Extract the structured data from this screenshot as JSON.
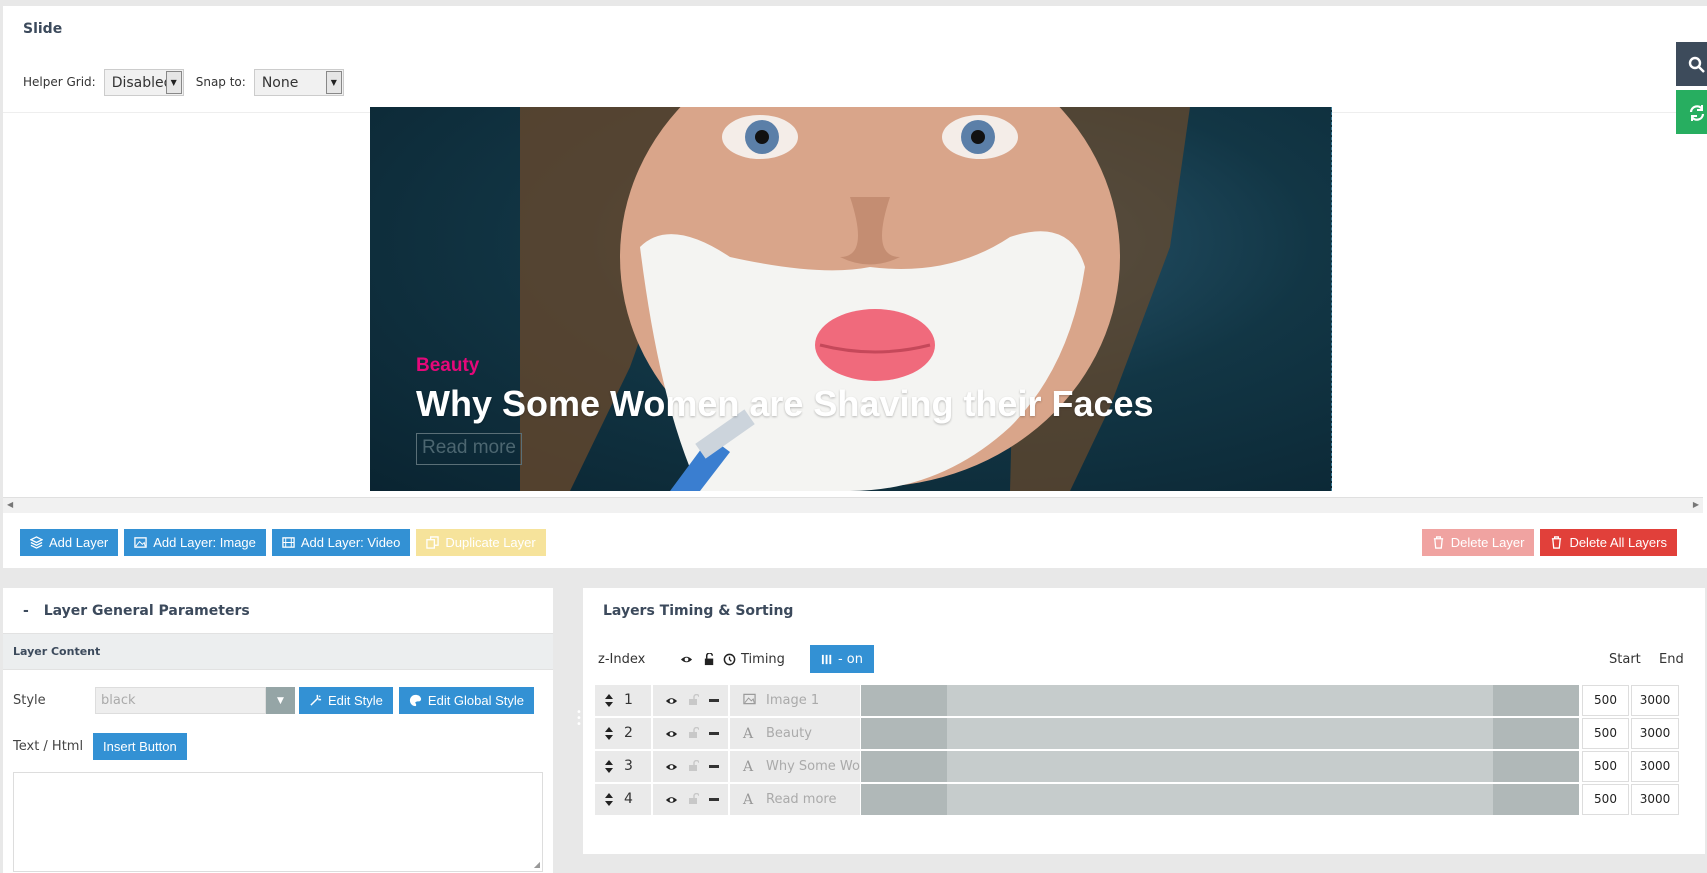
{
  "slide": {
    "title": "Slide",
    "helper_grid_label": "Helper Grid:",
    "helper_grid_value": "Disabled",
    "snap_label": "Snap to:",
    "snap_value": "None"
  },
  "canvas": {
    "layer_beauty": "Beauty",
    "layer_headline": "Why Some Women are Shaving their Faces",
    "layer_readmore": "Read more"
  },
  "toolbar": {
    "add_layer": "Add Layer",
    "add_layer_image": "Add Layer: Image",
    "add_layer_video": "Add Layer: Video",
    "duplicate_layer": "Duplicate Layer",
    "delete_layer": "Delete Layer",
    "delete_all_layers": "Delete All Layers"
  },
  "params": {
    "header": "Layer General Parameters",
    "header_toggle": "-",
    "sub_header": "Layer Content",
    "style_label": "Style",
    "style_value": "black",
    "edit_style": "Edit Style",
    "edit_global_style": "Edit Global Style",
    "text_html_label": "Text / Html",
    "insert_button": "Insert Button",
    "textarea_value": ""
  },
  "timing": {
    "title": "Layers Timing & Sorting",
    "zindex_label": "z-Index",
    "timing_label": "Timing",
    "toggle_label": "- on",
    "start_label": "Start",
    "end_label": "End",
    "layers": [
      {
        "z": "1",
        "type_icon": "image-icon",
        "name": "Image 1",
        "start": "500",
        "end": "3000"
      },
      {
        "z": "2",
        "type_icon": "text-icon",
        "name": "Beauty",
        "start": "500",
        "end": "3000"
      },
      {
        "z": "3",
        "type_icon": "text-icon",
        "name": "Why Some Women are S...",
        "start": "500",
        "end": "3000"
      },
      {
        "z": "4",
        "type_icon": "text-icon",
        "name": "Read more",
        "start": "500",
        "end": "3000"
      }
    ]
  },
  "colors": {
    "primary_blue": "#3391d4",
    "danger_red": "#e1403a",
    "accent_pink": "#e5087a",
    "search_dark": "#3d4b5b",
    "refresh_green": "#27ae60"
  }
}
